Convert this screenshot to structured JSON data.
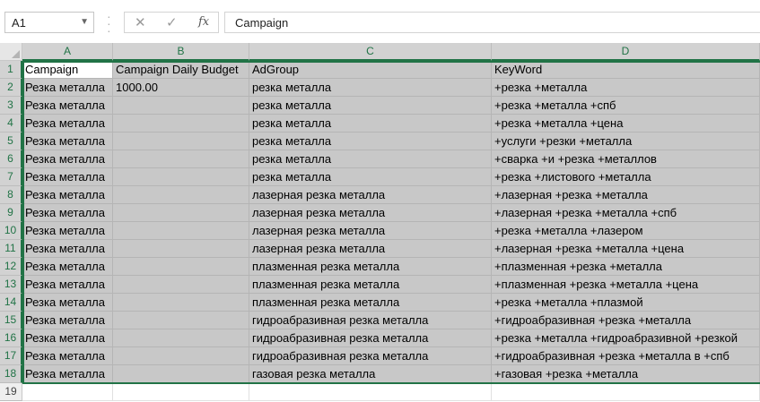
{
  "formula_bar": {
    "name_box": "A1",
    "formula": "Campaign"
  },
  "columns": [
    "A",
    "B",
    "C",
    "D"
  ],
  "row_numbers": [
    "1",
    "2",
    "3",
    "4",
    "5",
    "6",
    "7",
    "8",
    "9",
    "10",
    "11",
    "12",
    "13",
    "14",
    "15",
    "16",
    "17",
    "18",
    "19"
  ],
  "rows": [
    [
      "Campaign",
      "Campaign Daily Budget",
      "AdGroup",
      "KeyWord"
    ],
    [
      "Резка металла",
      "1000.00",
      "резка металла",
      "+резка +металла"
    ],
    [
      "Резка металла",
      "",
      "резка металла",
      "+резка +металла +спб"
    ],
    [
      "Резка металла",
      "",
      "резка металла",
      "+резка +металла +цена"
    ],
    [
      "Резка металла",
      "",
      "резка металла",
      "+услуги +резки +металла"
    ],
    [
      "Резка металла",
      "",
      "резка металла",
      "+сварка +и +резка +металлов"
    ],
    [
      "Резка металла",
      "",
      "резка металла",
      "+резка +листового +металла"
    ],
    [
      "Резка металла",
      "",
      "лазерная резка металла",
      "+лазерная +резка +металла"
    ],
    [
      "Резка металла",
      "",
      "лазерная резка металла",
      "+лазерная +резка +металла +спб"
    ],
    [
      "Резка металла",
      "",
      "лазерная резка металла",
      "+резка +металла +лазером"
    ],
    [
      "Резка металла",
      "",
      "лазерная резка металла",
      "+лазерная +резка +металла +цена"
    ],
    [
      "Резка металла",
      "",
      "плазменная резка металла",
      "+плазменная +резка +металла"
    ],
    [
      "Резка металла",
      "",
      "плазменная резка металла",
      "+плазменная +резка +металла +цена"
    ],
    [
      "Резка металла",
      "",
      "плазменная резка металла",
      "+резка +металла +плазмой"
    ],
    [
      "Резка металла",
      "",
      "гидроабразивная резка металла",
      "+гидроабразивная +резка +металла"
    ],
    [
      "Резка металла",
      "",
      "гидроабразивная резка металла",
      "+резка +металла +гидроабразивной +резкой"
    ],
    [
      "Резка металла",
      "",
      "гидроабразивная резка металла",
      "+гидроабразивная +резка +металла в +спб"
    ],
    [
      "Резка металла",
      "",
      "газовая резка металла",
      "+газовая +резка +металла"
    ]
  ],
  "colors": {
    "accent": "#217346",
    "selection": "#c8c8c8"
  }
}
